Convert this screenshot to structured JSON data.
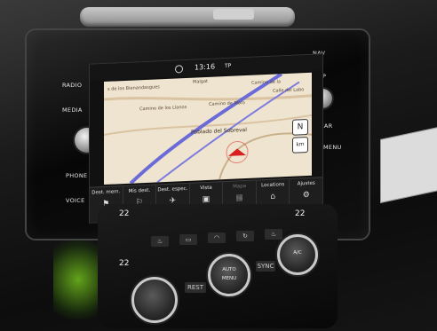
{
  "status_bar": {
    "time": "13:16",
    "signal": "TP"
  },
  "left_buttons": [
    "RADIO",
    "MEDIA",
    "PHONE",
    "VOICE"
  ],
  "right_buttons": [
    "NAV",
    "APP",
    "CAR",
    "MENU"
  ],
  "map_labels": {
    "l1": "s de los Bienandasgues",
    "l2": "Malgat",
    "l3": "Camino de los Llanos",
    "l4": "Camino de Moro",
    "l5": "Poblado del Sobreval",
    "l6": "Camino de la",
    "l7": "Calle del Labo"
  },
  "softkeys": [
    {
      "label": "Dest. mem.",
      "icon": "destination-memory-icon",
      "glyph": "⚑"
    },
    {
      "label": "Mis dest.",
      "icon": "my-destinations-icon",
      "glyph": "⚐"
    },
    {
      "label": "Dest. espec.",
      "icon": "special-destination-icon",
      "glyph": "✈"
    },
    {
      "label": "Vista",
      "icon": "view-icon",
      "glyph": "▣"
    },
    {
      "label": "Mapa",
      "icon": "map-icon",
      "glyph": "▦",
      "dim": true
    },
    {
      "label": "Locations",
      "icon": "locations-icon",
      "glyph": "⌂"
    },
    {
      "label": "Ajustes",
      "icon": "settings-icon",
      "glyph": "⚙"
    }
  ],
  "map_controls": {
    "compass": "N",
    "zoom": "km"
  },
  "climate": {
    "temp_left": "22",
    "temp_right": "22",
    "temp_left_2": "22",
    "dial_center": [
      "AUTO",
      "MENU"
    ],
    "rest": "REST",
    "sync": "SYNC",
    "fan_dial_label": "A/C"
  },
  "colors": {
    "map_bg": "#efe4cf",
    "route": "#6a6ad8",
    "road": "#d9c3a0",
    "accent": "#d81e1e"
  }
}
